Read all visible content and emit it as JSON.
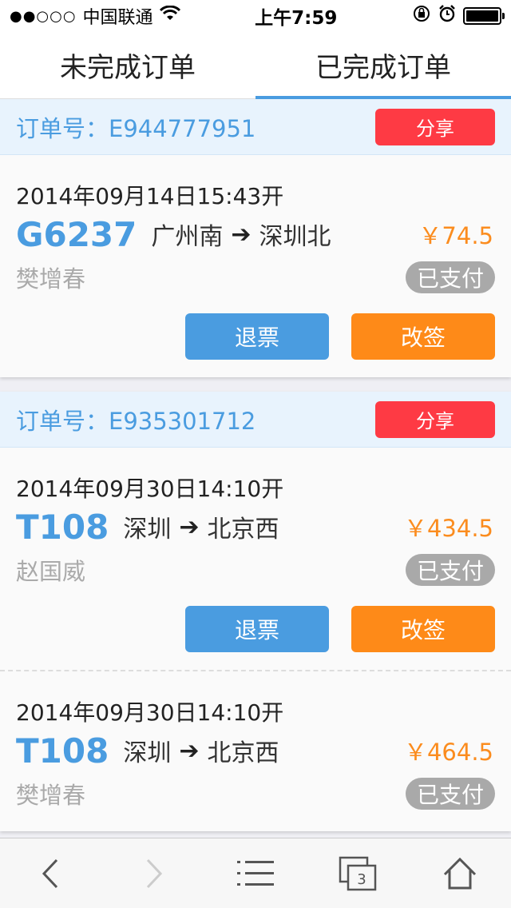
{
  "status_bar": {
    "signal_dots": "●●○○○",
    "carrier": "中国联通",
    "time": "上午7:59"
  },
  "tabs": [
    {
      "label": "未完成订单",
      "active": false
    },
    {
      "label": "已完成订单",
      "active": true
    }
  ],
  "orders": [
    {
      "order_no": "订单号：E944777951",
      "share_label": "分享",
      "tickets": [
        {
          "depart_time": "2014年09月14日15:43开",
          "train": "G6237",
          "from": "广州南",
          "to": "深圳北",
          "price": "￥74.5",
          "passenger": "樊增春",
          "status": "已支付",
          "refund_label": "退票",
          "change_label": "改签"
        }
      ]
    },
    {
      "order_no": "订单号：E935301712",
      "share_label": "分享",
      "tickets": [
        {
          "depart_time": "2014年09月30日14:10开",
          "train": "T108",
          "from": "深圳",
          "to": "北京西",
          "price": "￥434.5",
          "passenger": "赵国威",
          "status": "已支付",
          "refund_label": "退票",
          "change_label": "改签"
        },
        {
          "depart_time": "2014年09月30日14:10开",
          "train": "T108",
          "from": "深圳",
          "to": "北京西",
          "price": "￥464.5",
          "passenger": "樊增春",
          "status": "已支付"
        }
      ]
    }
  ],
  "toolbar": {
    "tabs_count": "3",
    "icons": [
      "back-icon",
      "forward-icon",
      "menu-list-icon",
      "tabs-icon",
      "home-icon"
    ]
  },
  "colors": {
    "accent_blue": "#4a9ce0",
    "share_red": "#fe3a44",
    "change_orange": "#fe8a18",
    "price_orange": "#fb8c1e",
    "paid_gray": "#a9a9a9"
  }
}
